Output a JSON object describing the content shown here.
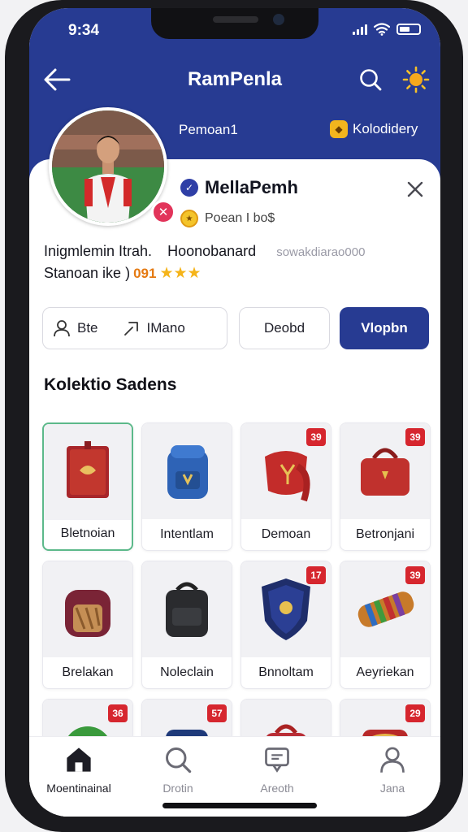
{
  "status_bar": {
    "time": "9:34"
  },
  "header": {
    "title": "RamPenla"
  },
  "subnav": {
    "left_label": "Pemoan1",
    "right_label": "Kolodidery"
  },
  "profile": {
    "name": "MellaPemh",
    "subtitle": "Poean I bo$",
    "info_line1": [
      "Inigmlemin Itrah.",
      "Hoonobanard",
      "sowakdiarao000"
    ],
    "info_line2_label": "Stanoan ike )",
    "rating": "091",
    "stars": 3
  },
  "actions": {
    "outline_left": "Bte",
    "outline_right": "IMano",
    "middle": "Deobd",
    "primary": "Vlopbn"
  },
  "collection": {
    "title": "Kolektio Sadens",
    "items": [
      {
        "label": "Bletnoian",
        "tag": "",
        "selected": true,
        "art": "red-book-icon"
      },
      {
        "label": "Intentlam",
        "tag": "",
        "selected": false,
        "art": "blue-backpack-icon"
      },
      {
        "label": "Demoan",
        "tag": "39",
        "selected": false,
        "art": "red-scarf-icon"
      },
      {
        "label": "Betronjani",
        "tag": "39",
        "selected": false,
        "art": "red-handbag-icon"
      },
      {
        "label": "Brelakan",
        "tag": "",
        "selected": false,
        "art": "maroon-backpack-icon"
      },
      {
        "label": "Noleclain",
        "tag": "",
        "selected": false,
        "art": "black-backpack-icon"
      },
      {
        "label": "Bnnoltam",
        "tag": "17",
        "selected": false,
        "art": "navy-shield-icon"
      },
      {
        "label": "Aeyriekan",
        "tag": "39",
        "selected": false,
        "art": "striped-tube-icon"
      },
      {
        "label": "",
        "tag": "36",
        "selected": false,
        "art": "green-ball-icon"
      },
      {
        "label": "",
        "tag": "57",
        "selected": false,
        "art": "navy-bag-icon"
      },
      {
        "label": "",
        "tag": "",
        "selected": false,
        "art": "red-bag-icon"
      },
      {
        "label": "",
        "tag": "29",
        "selected": false,
        "art": "red-gold-bag-icon"
      }
    ]
  },
  "bottom_nav": [
    {
      "label": "Moentinainal",
      "icon": "home-icon",
      "active": true
    },
    {
      "label": "Drotin",
      "icon": "search-icon",
      "active": false
    },
    {
      "label": "Areoth",
      "icon": "message-icon",
      "active": false
    },
    {
      "label": "Jana",
      "icon": "profile-icon",
      "active": false
    }
  ],
  "colors": {
    "brand": "#273b92",
    "accent": "#e2345a",
    "tag": "#d6262e",
    "star": "#f5b41a"
  }
}
